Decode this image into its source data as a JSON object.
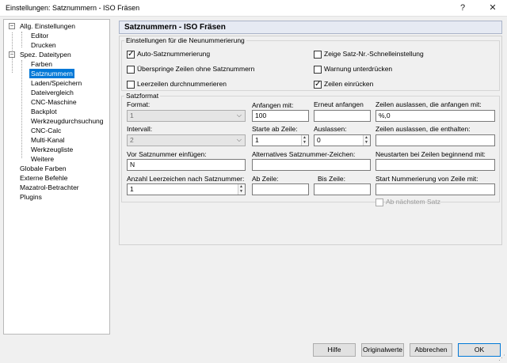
{
  "window": {
    "title": "Einstellungen: Satznummern - ISO Fräsen",
    "help_icon": "?",
    "close_icon": "✕"
  },
  "tree": {
    "items": [
      {
        "label": "Allg. Einstellungen",
        "toggle": "−"
      },
      {
        "label": "Editor"
      },
      {
        "label": "Drucken"
      },
      {
        "label": "Spez. Dateitypen",
        "toggle": "−"
      },
      {
        "label": "Farben"
      },
      {
        "label": "Satznummern"
      },
      {
        "label": "Laden/Speichern"
      },
      {
        "label": "Dateivergleich"
      },
      {
        "label": "CNC-Maschine"
      },
      {
        "label": "Backplot"
      },
      {
        "label": "Werkzeugdurchsuchung"
      },
      {
        "label": "CNC-Calc"
      },
      {
        "label": "Multi-Kanal"
      },
      {
        "label": "Werkzeugliste"
      },
      {
        "label": "Weitere"
      },
      {
        "label": "Globale Farben"
      },
      {
        "label": "Externe Befehle"
      },
      {
        "label": "Mazatrol-Betrachter"
      },
      {
        "label": "Plugins"
      }
    ],
    "selected": "Satznummern"
  },
  "header": {
    "title": "Satznummern - ISO Fräsen"
  },
  "renumbering": {
    "title": "Einstellungen für die Neunummerierung",
    "auto": {
      "label": "Auto-Satznummerierung",
      "checked": true
    },
    "skip_lines": {
      "label": "Überspringe Zeilen ohne Satznummern",
      "checked": false
    },
    "number_empty": {
      "label": "Leerzeilen durchnummerieren",
      "checked": false
    },
    "quick_setting": {
      "label": "Zeige Satz-Nr.-Schnelleinstellung",
      "checked": false
    },
    "suppress_warning": {
      "label": "Warnung unterdrücken",
      "checked": false
    },
    "indent": {
      "label": "Zeilen einrücken",
      "checked": true
    }
  },
  "format": {
    "title": "Satzformat",
    "format_label": "Format:",
    "format_value": "1",
    "start_label": "Anfangen mit:",
    "start_value": "100",
    "restart_label": "Erneut anfangen",
    "restart_value": "",
    "skip_starting_label": "Zeilen auslassen, die anfangen mit:",
    "skip_starting_value": "%,0",
    "interval_label": "Intervall:",
    "interval_value": "2",
    "start_line_label": "Starte ab Zeile:",
    "start_line_value": "1",
    "omit_label": "Auslassen:",
    "omit_value": "0",
    "skip_containing_label": "Zeilen auslassen, die enthalten:",
    "skip_containing_value": "",
    "prefix_label": "Vor Satznummer einfügen:",
    "prefix_value": "N",
    "alt_char_label": "Alternatives Satznummer-Zeichen:",
    "alt_char_value": "",
    "restart_on_label": "Neustarten bei Zeilen beginnend mit:",
    "restart_on_value": "",
    "spaces_label": "Anzahl Leerzeichen nach Satznummer:",
    "spaces_value": "1",
    "from_line_label": "Ab Zeile:",
    "from_line_value": "",
    "to_line_label": "Bis Zeile:",
    "to_line_value": "",
    "start_renum_label": "Start Nummerierung von Zeile mit:",
    "start_renum_value": "",
    "next_block": {
      "label": "Ab nächstem Satz",
      "checked": false
    }
  },
  "buttons": {
    "help": "Hilfe",
    "defaults": "Originalwerte",
    "cancel": "Abbrechen",
    "ok": "OK"
  }
}
